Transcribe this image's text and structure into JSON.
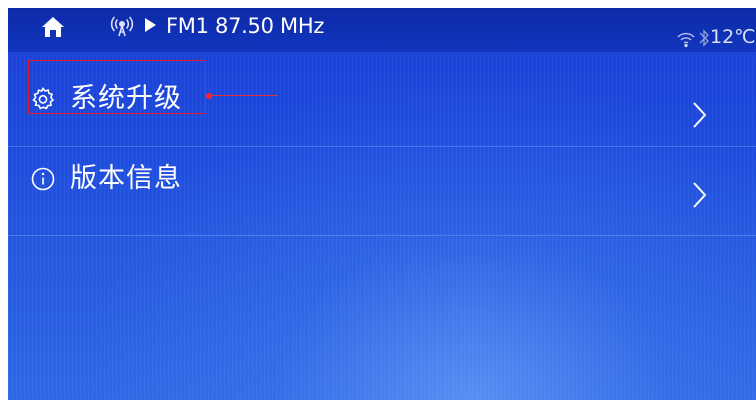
{
  "status_bar": {
    "station": "FM1 87.50 MHz",
    "temperature": "12℃",
    "icons": [
      "home-icon",
      "radio-icon",
      "play-icon",
      "wifi-icon",
      "bluetooth-icon"
    ]
  },
  "menu": {
    "items": [
      {
        "label": "系统升级",
        "icon": "gear-icon",
        "highlighted": true
      },
      {
        "label": "版本信息",
        "icon": "info-icon",
        "highlighted": false
      }
    ]
  },
  "colors": {
    "background_top": "#1a3fd6",
    "background_bottom": "#2f68e6",
    "status_bar": "#0d2aa8",
    "highlight": "#e11d2d",
    "text": "#ffffff"
  }
}
